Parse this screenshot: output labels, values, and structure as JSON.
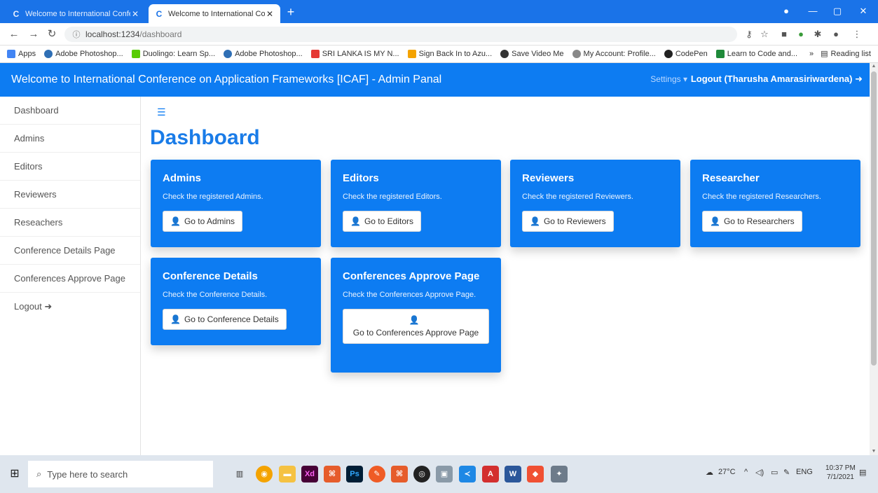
{
  "browser": {
    "tabs": [
      {
        "label": "Welcome to International Confe"
      },
      {
        "label": "Welcome to International Confe"
      }
    ],
    "url_host": "localhost:1234",
    "url_path": "/dashboard",
    "bookmarks": [
      {
        "label": "Apps",
        "color": "#4285f4"
      },
      {
        "label": "Adobe Photoshop...",
        "color": "#2f6fb5"
      },
      {
        "label": "Duolingo: Learn Sp...",
        "color": "#58cc02"
      },
      {
        "label": "Adobe Photoshop...",
        "color": "#2f6fb5"
      },
      {
        "label": "SRI LANKA IS MY N...",
        "color": "#e53935"
      },
      {
        "label": "Sign Back In to Azu...",
        "color": "#f4a300"
      },
      {
        "label": "Save Video Me",
        "color": "#333333"
      },
      {
        "label": "My Account: Profile...",
        "color": "#888888"
      },
      {
        "label": "CodePen",
        "color": "#222222"
      },
      {
        "label": "Learn to Code and...",
        "color": "#1f8a3a"
      }
    ],
    "reading_list": "Reading list"
  },
  "header": {
    "title": "Welcome to International Conference on Application Frameworks [ICAF] - Admin Panal",
    "settings": "Settings ▾",
    "logout": "Logout (Tharusha Amarasiriwardena) ➜"
  },
  "sidebar": {
    "items": [
      {
        "label": "Dashboard"
      },
      {
        "label": "Admins"
      },
      {
        "label": "Editors"
      },
      {
        "label": "Reviewers"
      },
      {
        "label": "Reseachers"
      },
      {
        "label": "Conference Details Page"
      },
      {
        "label": "Conferences Approve Page"
      },
      {
        "label": "Logout ➜"
      }
    ]
  },
  "main": {
    "title": "Dashboard",
    "cards": [
      {
        "title": "Admins",
        "text": "Check the registered Admins.",
        "button": "Go to Admins"
      },
      {
        "title": "Editors",
        "text": "Check the registered Editors.",
        "button": "Go to Editors"
      },
      {
        "title": "Reviewers",
        "text": "Check the registered Reviewers.",
        "button": "Go to Reviewers"
      },
      {
        "title": "Researcher",
        "text": "Check the registered Researchers.",
        "button": "Go to Researchers"
      },
      {
        "title": "Conference Details",
        "text": "Check the Conference Details.",
        "button": "Go to Conference Details"
      },
      {
        "title": "Conferences Approve Page",
        "text": "Check the Conferences Approve Page.",
        "button": "Go to Conferences Approve Page"
      }
    ]
  },
  "taskbar": {
    "search_placeholder": "Type here to search",
    "weather": "27°C",
    "lang": "ENG",
    "time": "10:37 PM",
    "date": "7/1/2021"
  },
  "colors": {
    "primary": "#0d7cf2",
    "browser_chrome": "#1a73e8"
  }
}
